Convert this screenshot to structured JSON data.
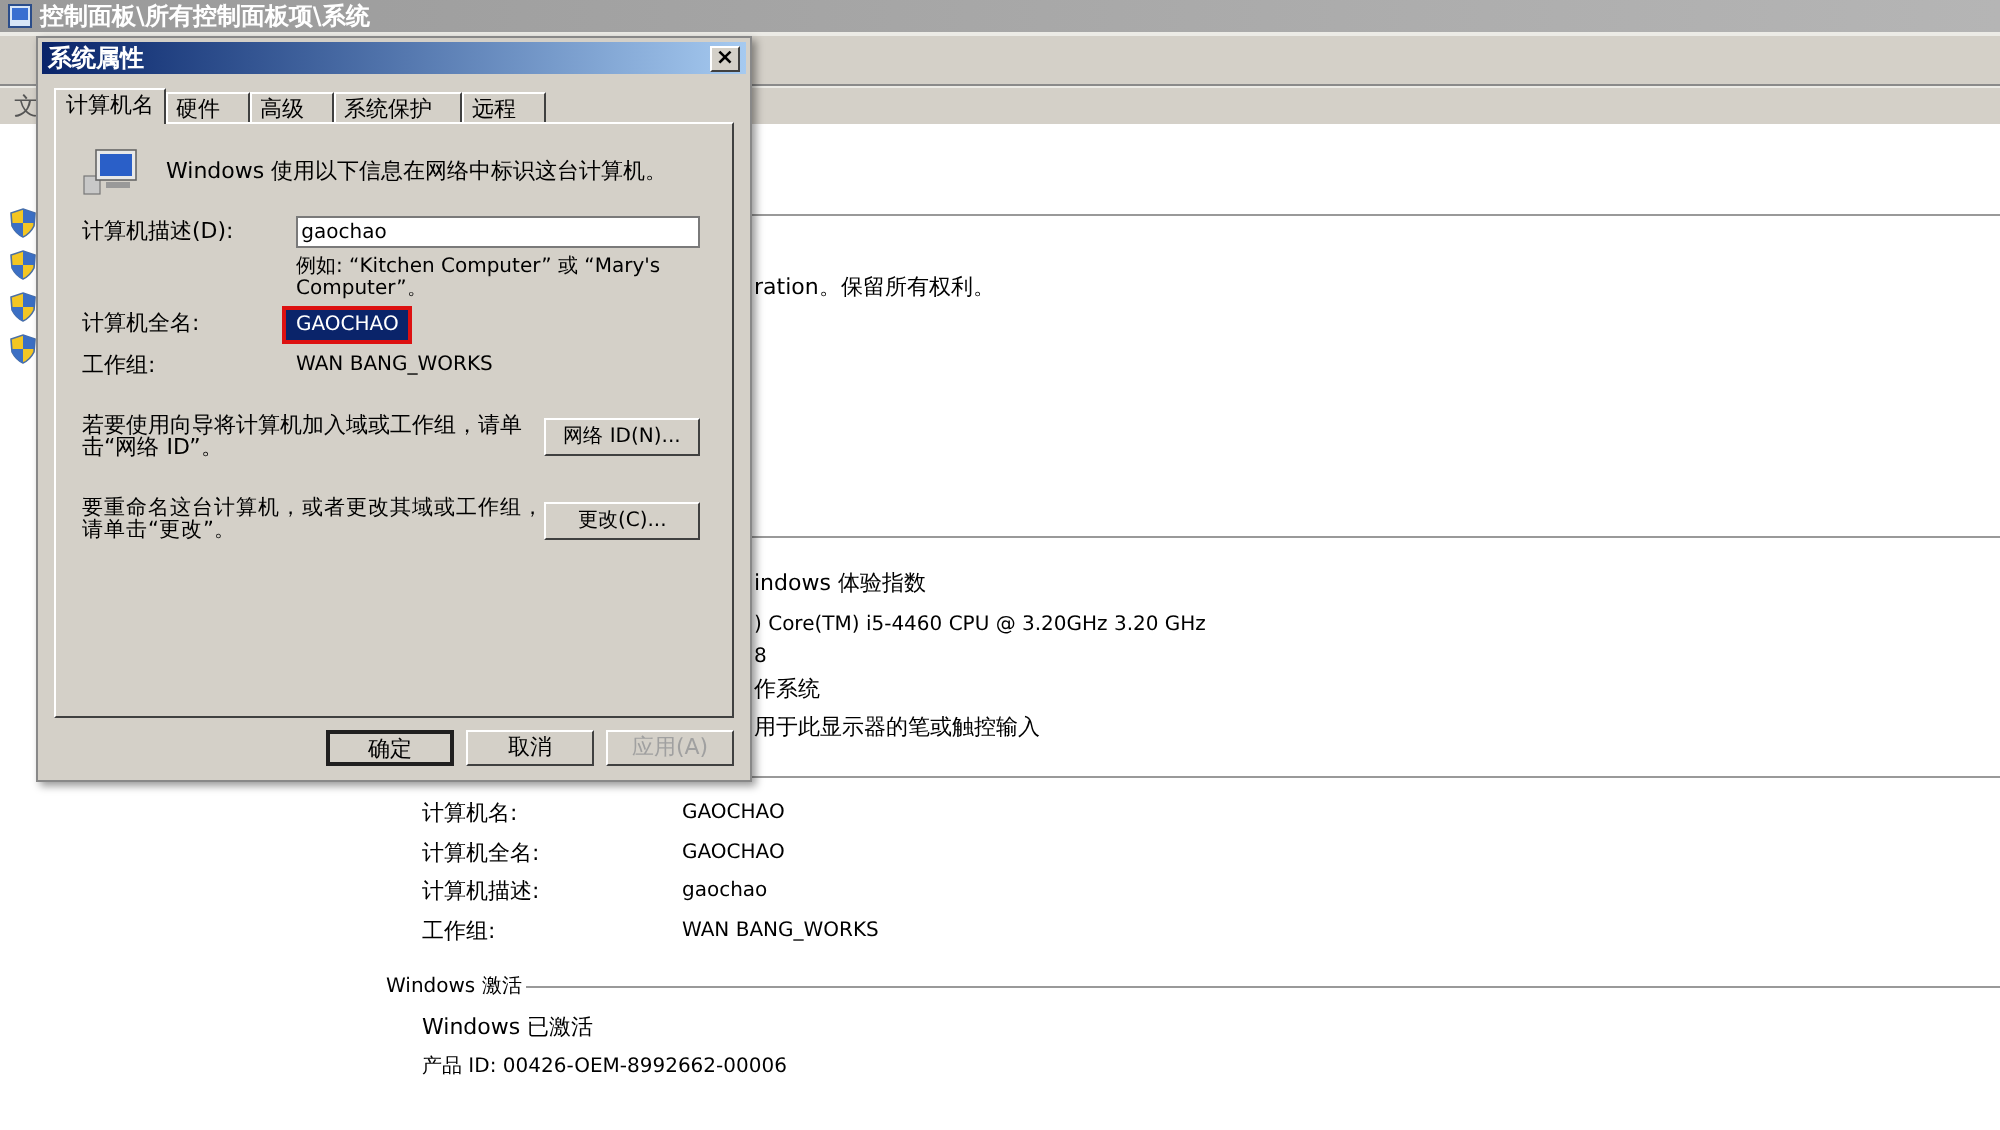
{
  "window": {
    "title": "控制面板\\所有控制面板项\\系统"
  },
  "menu": [
    "文"
  ],
  "background": {
    "copyright": "ration。保留所有权利。",
    "rating": "indows 体验指数",
    "processor": ") Core(TM) i5-4460  CPU @ 3.20GHz   3.20 GHz",
    "memory": "8",
    "system_type": "作系统",
    "pen_touch": "用于此显示器的笔或触控输入",
    "computer_info": [
      {
        "label": "计算机名:",
        "value": "GAOCHAO"
      },
      {
        "label": "计算机全名:",
        "value": "GAOCHAO"
      },
      {
        "label": "计算机描述:",
        "value": "gaochao"
      },
      {
        "label": "工作组:",
        "value": "WAN BANG_WORKS"
      }
    ],
    "activation": {
      "heading": "Windows 激活",
      "status": "Windows 已激活",
      "product_id": "产品 ID: 00426-OEM-8992662-00006"
    }
  },
  "dialog": {
    "title": "系统属性",
    "close": "×",
    "tabs": [
      {
        "label": "计算机名",
        "selected": true
      },
      {
        "label": "硬件",
        "selected": false
      },
      {
        "label": "高级",
        "selected": false
      },
      {
        "label": "系统保护",
        "selected": false
      },
      {
        "label": "远程",
        "selected": false
      }
    ],
    "intro": "Windows 使用以下信息在网络中标识这台计算机。",
    "description_label": "计算机描述(D):",
    "description_value": "gaochao",
    "example": "例如: “Kitchen Computer” 或 “Mary's Computer”。",
    "full_name_label": "计算机全名:",
    "full_name_value": "GAOCHAO",
    "full_name_selected": true,
    "workgroup_label": "工作组:",
    "workgroup_value": "WAN BANG_WORKS",
    "network_text": "若要使用向导将计算机加入域或工作组，请单击“网络 ID”。",
    "network_button": "网络 ID(N)...",
    "rename_text": "要重命名这台计算机，或者更改其域或工作组，请单击“更改”。",
    "rename_button": "更改(C)...",
    "buttons": [
      {
        "label": "确定",
        "disabled": false,
        "default": true
      },
      {
        "label": "取消",
        "disabled": false,
        "default": false
      },
      {
        "label": "应用(A)",
        "disabled": true,
        "default": false
      }
    ]
  }
}
